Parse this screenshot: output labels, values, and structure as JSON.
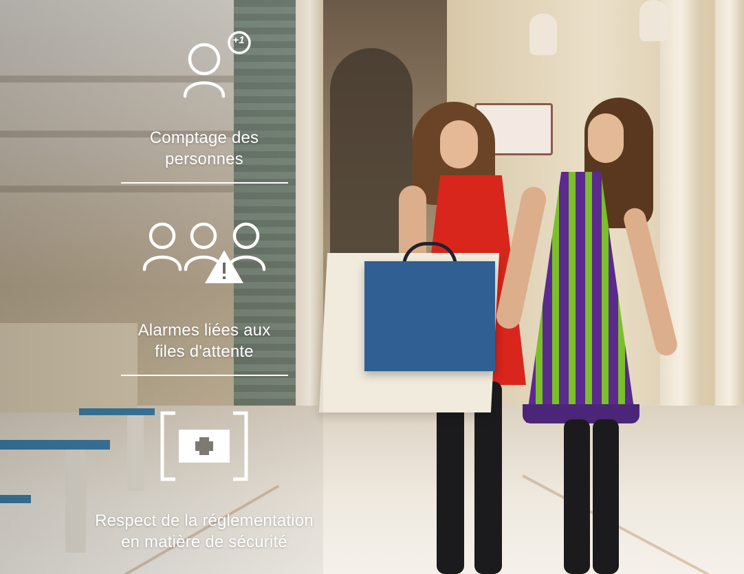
{
  "features": [
    {
      "icon": "person-count-icon",
      "badge": "+1",
      "line1": "Comptage des",
      "line2": "personnes"
    },
    {
      "icon": "queue-alarm-icon",
      "line1": "Alarmes liées aux",
      "line2": "files d'attente"
    },
    {
      "icon": "safety-first-aid-icon",
      "line1": "Respect de la réglementation",
      "line2": "en matière de sécurité"
    }
  ],
  "colors": {
    "overlay_text": "#ffffff",
    "bag_blue": "#2f5f93",
    "dress_red": "#d9261c",
    "dress_purple": "#5a2a8c",
    "dress_green": "#7bbf2a"
  }
}
